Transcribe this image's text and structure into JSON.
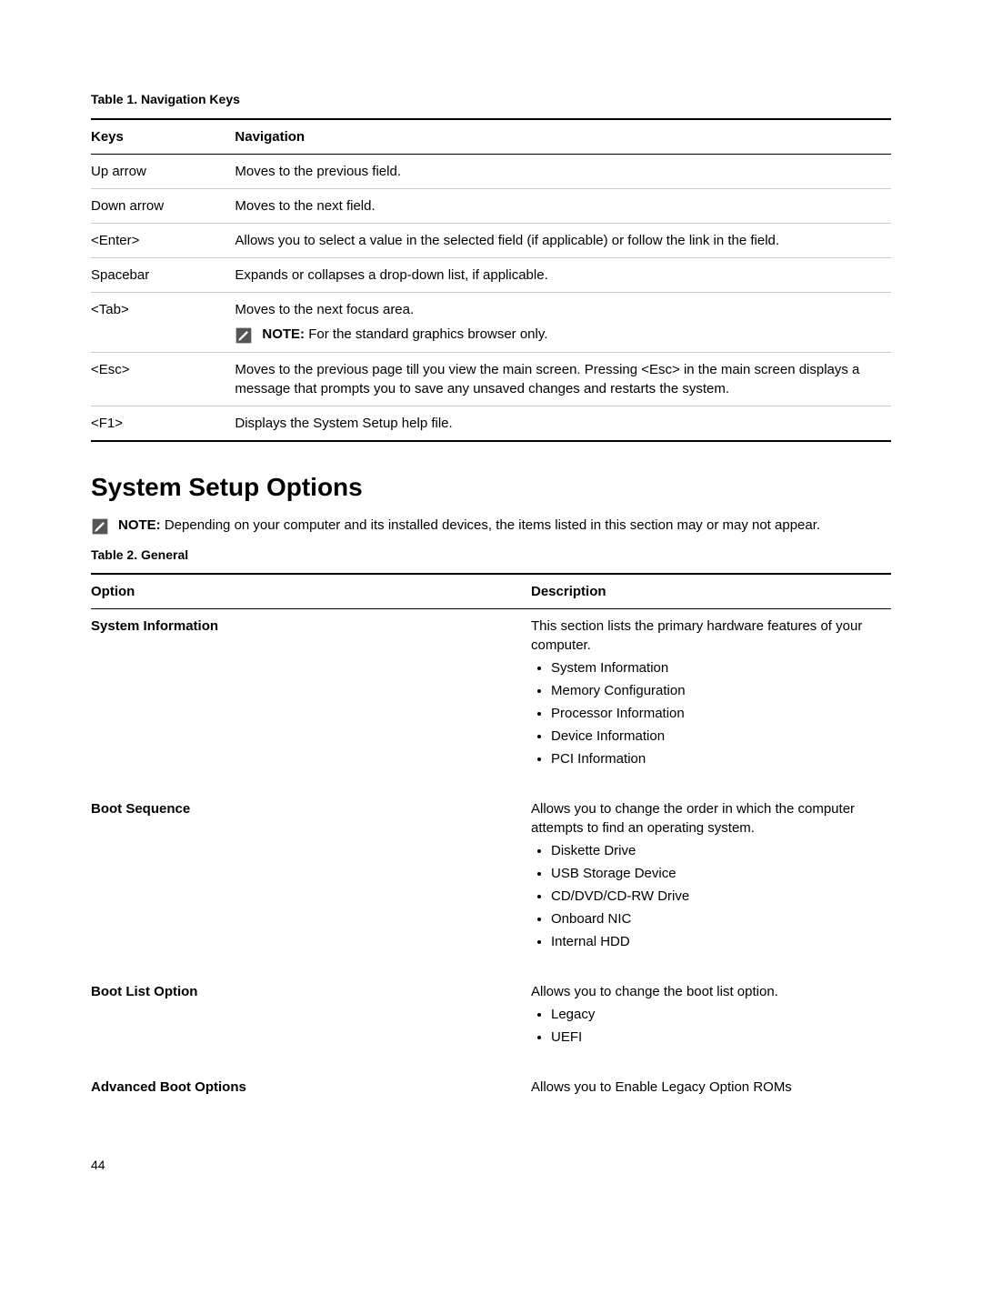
{
  "table1": {
    "caption": "Table 1. Navigation Keys",
    "head": {
      "col1": "Keys",
      "col2": "Navigation"
    },
    "rows": {
      "up": {
        "k": "Up arrow",
        "n": "Moves to the previous field."
      },
      "down": {
        "k": "Down arrow",
        "n": "Moves to the next field."
      },
      "enter": {
        "k": "<Enter>",
        "n": "Allows you to select a value in the selected field (if applicable) or follow the link in the field."
      },
      "space": {
        "k": "Spacebar",
        "n": "Expands or collapses a drop-down list, if applicable."
      },
      "tab": {
        "k": "<Tab>",
        "n": "Moves to the next focus area.",
        "note_label": "NOTE:",
        "note_body": " For the standard graphics browser only."
      },
      "esc": {
        "k": "<Esc>",
        "n": "Moves to the previous page till you view the main screen. Pressing <Esc> in the main screen displays a message that prompts you to save any unsaved changes and restarts the system."
      },
      "f1": {
        "k": "<F1>",
        "n": "Displays the System Setup help file."
      }
    }
  },
  "section_heading": "System Setup Options",
  "section_note": {
    "label": "NOTE:",
    "body": " Depending on your computer and its installed devices, the items listed in this section may or may not appear."
  },
  "table2": {
    "caption": "Table 2. General",
    "head": {
      "col1": "Option",
      "col2": "Description"
    },
    "rows": {
      "sysinfo": {
        "option": "System Information",
        "desc": "This section lists the primary hardware features of your computer.",
        "bullets": [
          "System Information",
          "Memory Configuration",
          "Processor Information",
          "Device Information",
          "PCI Information"
        ]
      },
      "bootseq": {
        "option": "Boot Sequence",
        "desc": "Allows you to change the order in which the computer attempts to find an operating system.",
        "bullets": [
          "Diskette Drive",
          "USB Storage Device",
          "CD/DVD/CD-RW Drive",
          "Onboard NIC",
          "Internal HDD"
        ]
      },
      "bootlist": {
        "option": "Boot List Option",
        "desc": "Allows you to change the boot list option.",
        "bullets": [
          "Legacy",
          "UEFI"
        ]
      },
      "advboot": {
        "option": "Advanced Boot Options",
        "desc": "Allows you to Enable Legacy Option ROMs"
      }
    }
  },
  "page_number": "44"
}
